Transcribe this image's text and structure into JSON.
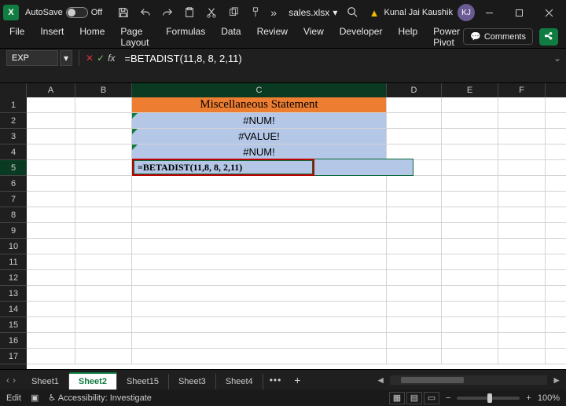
{
  "title": {
    "autosave_label": "AutoSave",
    "autosave_state": "Off",
    "filename": "sales.xlsx",
    "user_name": "Kunal Jai Kaushik",
    "user_initials": "KJ"
  },
  "ribbon": {
    "tabs": [
      "File",
      "Insert",
      "Home",
      "Page Layout",
      "Formulas",
      "Data",
      "Review",
      "View",
      "Developer",
      "Help",
      "Power Pivot"
    ],
    "comments_label": "Comments"
  },
  "formula_bar": {
    "name_box": "EXP",
    "formula": "=BETADIST(11,8, 8, 2,11)"
  },
  "grid": {
    "columns": [
      "A",
      "B",
      "C",
      "D",
      "E",
      "F"
    ],
    "rows": [
      "1",
      "2",
      "3",
      "4",
      "5",
      "6",
      "7",
      "8",
      "9",
      "10",
      "11",
      "12",
      "13",
      "14",
      "15",
      "16",
      "17"
    ],
    "active_col": "C",
    "active_row": "5",
    "c1": "Miscellaneous Statement",
    "c2": "#NUM!",
    "c3": "#VALUE!",
    "c4": "#NUM!",
    "c5_editing": "=BETADIST(11,8, 8, 2,11)"
  },
  "sheets": {
    "tabs": [
      "Sheet1",
      "Sheet2",
      "Sheet15",
      "Sheet3",
      "Sheet4"
    ],
    "active_index": 1
  },
  "status": {
    "mode": "Edit",
    "accessibility_label": "Accessibility: Investigate",
    "zoom": "100%"
  }
}
